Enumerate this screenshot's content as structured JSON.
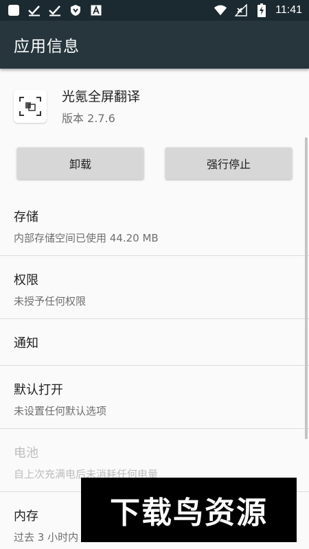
{
  "status_bar": {
    "time": "11:41",
    "icons_left": [
      "square-icon",
      "check-icon",
      "check-icon",
      "shield-icon",
      "a-icon"
    ],
    "icons_right": [
      "wifi-icon",
      "no-signal-icon",
      "battery-charging-icon"
    ]
  },
  "app_bar": {
    "title": "应用信息"
  },
  "app": {
    "name": "光氪全屏翻译",
    "version": "版本 2.7.6"
  },
  "buttons": {
    "uninstall": "卸载",
    "force_stop": "强行停止"
  },
  "sections": [
    {
      "title": "存储",
      "subtitle": "内部存储空间已使用 44.20 MB",
      "enabled": true
    },
    {
      "title": "权限",
      "subtitle": "未授予任何权限",
      "enabled": true
    },
    {
      "title": "通知",
      "subtitle": "",
      "enabled": true
    },
    {
      "title": "默认打开",
      "subtitle": "未设置任何默认选项",
      "enabled": true
    },
    {
      "title": "电池",
      "subtitle": "自上次充满电后未消耗任何电量",
      "enabled": false
    },
    {
      "title": "内存",
      "subtitle": "过去 3 小时内",
      "enabled": true
    }
  ],
  "watermark": {
    "text": "下载鸟资源"
  },
  "colors": {
    "status_bar": "#1b2a30",
    "app_bar": "#27363d",
    "button": "#d7d7d7",
    "background": "#fafafa"
  }
}
